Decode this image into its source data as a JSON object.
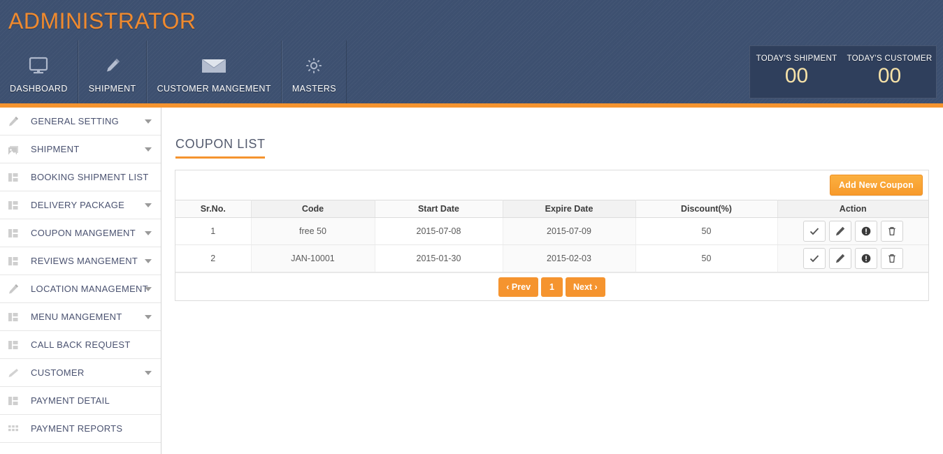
{
  "header": {
    "brand": "ADMINISTRATOR",
    "accent_color": "#f5942f",
    "bar_color": "#3d5070",
    "nav": [
      {
        "label": "DASHBOARD",
        "icon": "monitor-icon"
      },
      {
        "label": "SHIPMENT",
        "icon": "pencil-icon"
      },
      {
        "label": "CUSTOMER MANGEMENT",
        "icon": "envelope-icon"
      },
      {
        "label": "MASTERS",
        "icon": "gear-icon"
      }
    ],
    "stats": [
      {
        "label": "TODAY'S SHIPMENT",
        "value": "00"
      },
      {
        "label": "TODAY'S CUSTOMER",
        "value": "00"
      }
    ],
    "stat_value_color": "#f6e2a8"
  },
  "sidebar": {
    "items": [
      {
        "label": "GENERAL SETTING",
        "icon": "pencil-icon",
        "caret": true
      },
      {
        "label": "SHIPMENT",
        "icon": "images-icon",
        "caret": true
      },
      {
        "label": "BOOKING SHIPMENT LIST",
        "icon": "columns-icon",
        "caret": false
      },
      {
        "label": "DELIVERY PACKAGE",
        "icon": "columns-icon",
        "caret": true
      },
      {
        "label": "COUPON MANGEMENT",
        "icon": "columns-icon",
        "caret": true
      },
      {
        "label": "REVIEWS MANGEMENT",
        "icon": "columns-icon",
        "caret": true
      },
      {
        "label": "LOCATION MANAGEMENT",
        "icon": "pencil-icon",
        "caret": true
      },
      {
        "label": "MENU MANGEMENT",
        "icon": "columns-icon",
        "caret": true
      },
      {
        "label": "CALL BACK REQUEST",
        "icon": "columns-icon",
        "caret": false
      },
      {
        "label": "CUSTOMER",
        "icon": "pencil-icon",
        "caret": true
      },
      {
        "label": "PAYMENT DETAIL",
        "icon": "columns-icon",
        "caret": false
      },
      {
        "label": "PAYMENT REPORTS",
        "icon": "grid-icon",
        "caret": false
      }
    ]
  },
  "main": {
    "page_title": "COUPON LIST",
    "add_button": "Add New Coupon",
    "table": {
      "columns": [
        "Sr.No.",
        "Code",
        "Start Date",
        "Expire Date",
        "Discount(%)",
        "Action"
      ],
      "rows": [
        {
          "sr_no": "1",
          "code": "free 50",
          "start_date": "2015-07-08",
          "expire_date": "2015-07-09",
          "discount": "50"
        },
        {
          "sr_no": "2",
          "code": "JAN-10001",
          "start_date": "2015-01-30",
          "expire_date": "2015-02-03",
          "discount": "50"
        }
      ],
      "row_actions": [
        "check-icon",
        "pencil-icon",
        "exclamation-circle-icon",
        "trash-icon"
      ]
    },
    "pagination": {
      "prev": "‹ Prev",
      "pages": [
        "1"
      ],
      "next": "Next ›"
    }
  }
}
